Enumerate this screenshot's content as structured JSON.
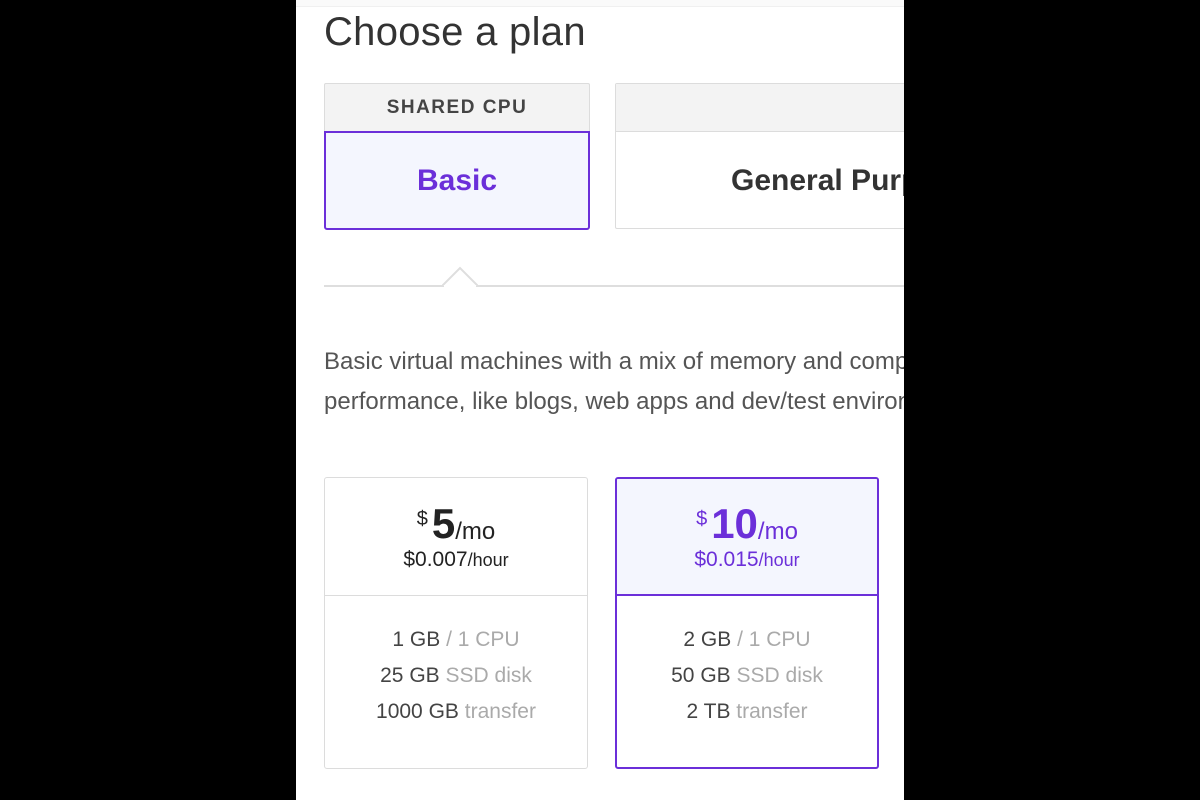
{
  "page": {
    "title": "Choose a plan"
  },
  "cpu_tabs": {
    "shared": {
      "category": "SHARED CPU",
      "option": "Basic"
    },
    "dedicated": {
      "category": "",
      "option": "General Purpose"
    }
  },
  "description": {
    "line1": "Basic virtual machines with a mix of memory and compute resources. Best for small projects that can handle variable levels of CPU",
    "line2": "performance, like blogs, web apps and dev/test environments."
  },
  "plans": [
    {
      "currency": "$",
      "amount": "5",
      "period": "/mo",
      "hourly": "$0.007",
      "hourly_unit": "/hour",
      "memory": "1 GB",
      "cpu": "/ 1 CPU",
      "disk": "25 GB",
      "disk_label": "SSD disk",
      "transfer": "1000 GB",
      "transfer_label": "transfer",
      "selected": false
    },
    {
      "currency": "$",
      "amount": "10",
      "period": "/mo",
      "hourly": "$0.015",
      "hourly_unit": "/hour",
      "memory": "2 GB",
      "cpu": "/ 1 CPU",
      "disk": "50 GB",
      "disk_label": "SSD disk",
      "transfer": "2 TB",
      "transfer_label": "transfer",
      "selected": true
    }
  ],
  "colors": {
    "accent": "#6b2fd9",
    "selected_bg": "#f4f6fe",
    "border": "#dcdcdc"
  }
}
